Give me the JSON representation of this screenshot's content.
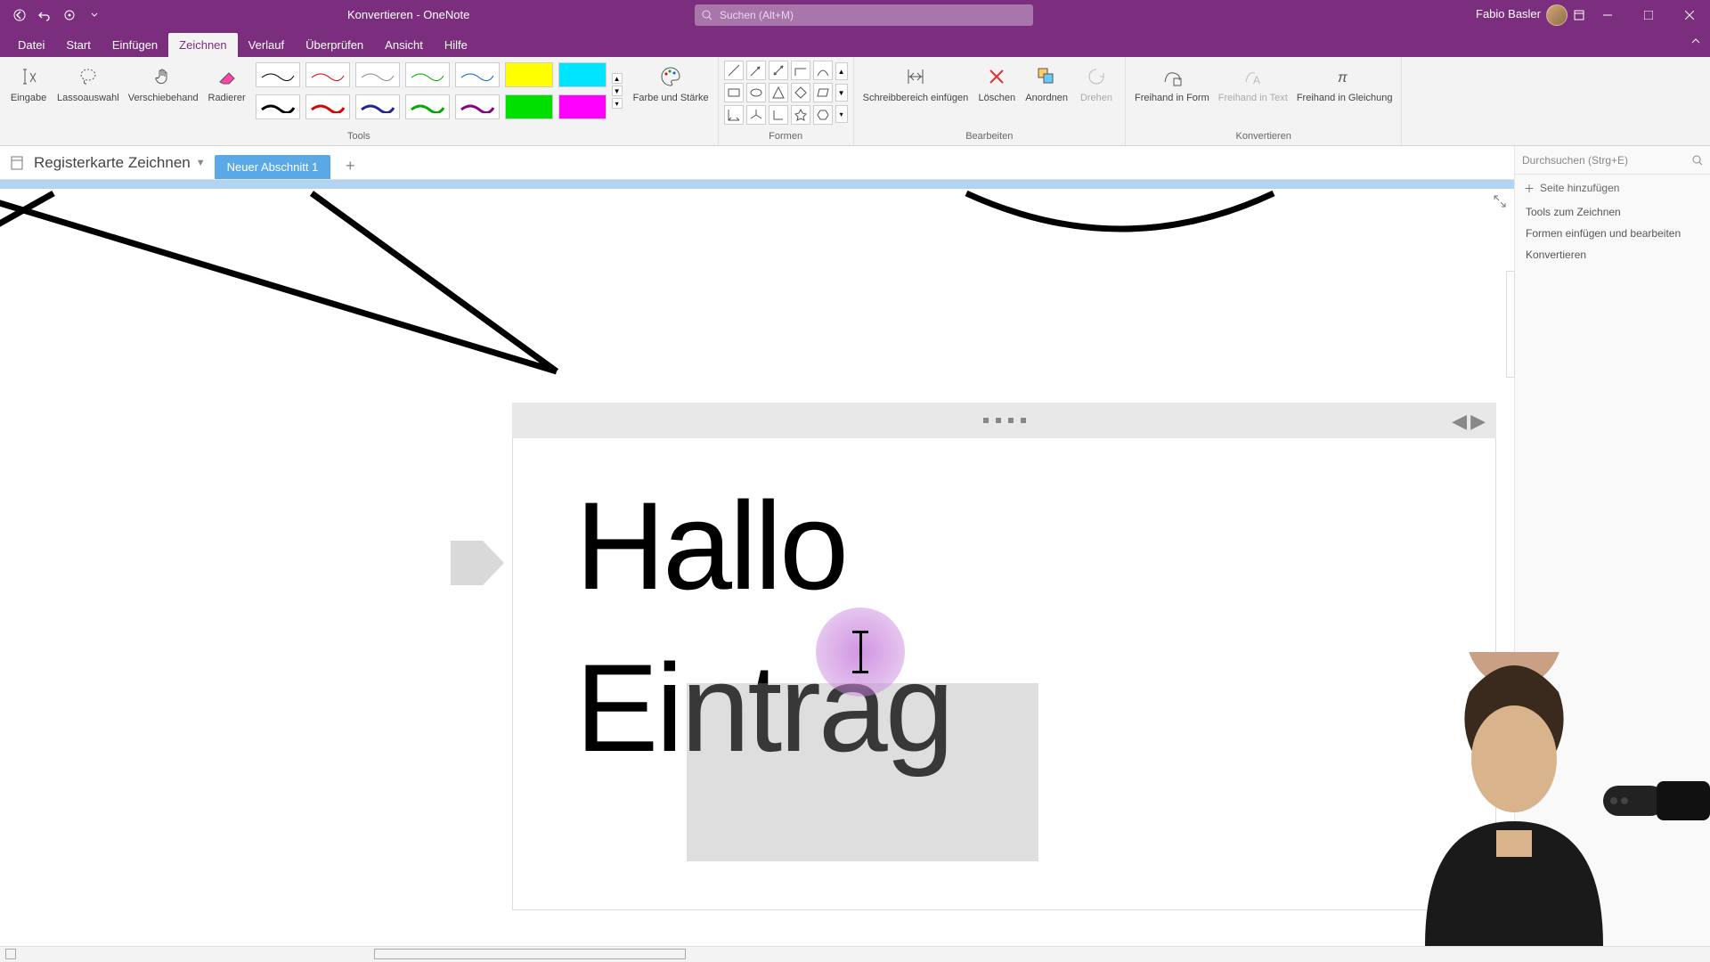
{
  "titlebar": {
    "title": "Konvertieren  -  OneNote",
    "search_placeholder": "Suchen (Alt+M)",
    "user_name": "Fabio Basler"
  },
  "tabs": {
    "datei": "Datei",
    "start": "Start",
    "einfuegen": "Einfügen",
    "zeichnen": "Zeichnen",
    "verlauf": "Verlauf",
    "ueberpruefen": "Überprüfen",
    "ansicht": "Ansicht",
    "hilfe": "Hilfe"
  },
  "ribbon": {
    "tools": {
      "eingabe": "Eingabe",
      "lasso": "Lassoauswahl",
      "hand": "Verschiebehand",
      "radierer": "Radierer",
      "farbe": "Farbe und Stärke",
      "group": "Tools"
    },
    "formen": {
      "group": "Formen"
    },
    "bearbeiten": {
      "schreib": "Schreibbereich einfügen",
      "loeschen": "Löschen",
      "anordnen": "Anordnen",
      "drehen": "Drehen",
      "group": "Bearbeiten"
    },
    "konvertieren": {
      "form": "Freihand in Form",
      "text": "Freihand in Text",
      "gleichung": "Freihand in Gleichung",
      "group": "Konvertieren"
    }
  },
  "notebook": {
    "name": "Registerkarte Zeichnen",
    "section": "Neuer Abschnitt 1"
  },
  "pagepanel": {
    "search": "Durchsuchen (Strg+E)",
    "addpage": "Seite hinzufügen",
    "items": [
      "Tools zum Zeichnen",
      "Formen einfügen und bearbeiten",
      "Konvertieren"
    ]
  },
  "note": {
    "line1": "Hallo",
    "line2": "Eintrag"
  },
  "colors": {
    "purple": "#7b2e7e",
    "section_blue": "#5aa9e6",
    "hl_yellow": "#ffff00",
    "hl_cyan": "#00e5ff",
    "hl_green": "#00e000",
    "hl_magenta": "#ff00ff"
  }
}
